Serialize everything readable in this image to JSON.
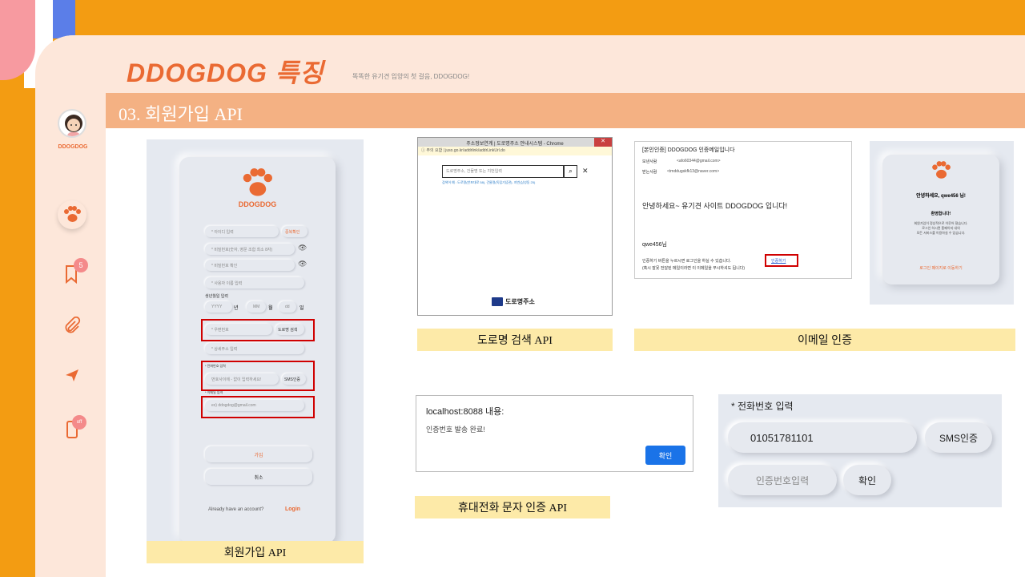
{
  "header": {
    "title": "DDOGDOG 특징",
    "subtitle": "똑똑한 유기견 입양의 첫 걸음, DDOGDOG!",
    "section": "03. 회원가입 API"
  },
  "sidebar": {
    "name": "DDOGDOG",
    "bookmark_badge": "5",
    "phone_badge": "off"
  },
  "signup": {
    "logo": "DDOGDOG",
    "id_placeholder": "* 아이디 입력",
    "id_check": "중복확인",
    "pw_placeholder": "* 비밀번호(숫자, 영문 조합 최소 8자)",
    "pw_confirm_placeholder": "* 비밀번호 확인",
    "name_placeholder": "* 사용자 이름 입력",
    "birth_label": "생년월일 입력",
    "year": "YYYY",
    "year_unit": "년",
    "month": "MM",
    "month_unit": "월",
    "day": "dd",
    "day_unit": "일",
    "zip_placeholder": "* 우편번호",
    "zip_button": "도로명 검색",
    "address_placeholder": "* 상세주소 입력",
    "phone_label": "* 전화번호 입력",
    "phone_placeholder": "번호사이에 - 없이 입력하세요!",
    "sms_button": "SMS인증",
    "email_label": "* 이메일 입력",
    "email_placeholder": "ex) ddogdog@gmail.com",
    "join_button": "가입",
    "cancel_button": "취소",
    "account_text": "Already have an account?",
    "login_link": "Login"
  },
  "road_popup": {
    "title": "주소정보연계 | 도로명주소 안내시스템 - Chrome",
    "url": "ⓘ 주의 요함 | juso.go.kr/addrlink/addrLinkUrl.do",
    "search_placeholder": "도로명주소, 건물명 또는 지번입력",
    "hint": "검색어 예 : 도로명(반포대로 58), 건물명(독립기념관), 지번(삼성동 25)",
    "brand": "도로명주소"
  },
  "email": {
    "subject": "[본인인증] DDOGDOG 인증메일입니다",
    "from_label": "보낸사람",
    "from": "<afo60344@gmail.com>",
    "to_label": "받는사람",
    "to": "<tmddugskfk13@naver.com>",
    "greeting": "안녕하세요~ 유기견 사이트 DDOGDOG 입니다!",
    "user": "qwe456님",
    "body1": "인증하기 버튼을 누르시면 로그인을 하실 수 있습니다.",
    "link": "인증하기",
    "body2": "(혹시 잘못 전달된 메일이라면 이 이메일을 무시하셔도 됩니다)"
  },
  "welcome": {
    "hello": "안녕하세요, qwe456 님!",
    "welcome": "환영합니다!",
    "msg1": "회원가입이 정상적으로 이루어 졌습니다.",
    "msg2": "로그인 하시면 홈페이지 내의",
    "msg3": "모든 서비스를 이용하실 수 있습니다.",
    "login_link": "로그인 페이지로 이동하기"
  },
  "alert": {
    "title": "localhost:8088 내용:",
    "message": "인증번호 발송 완료!",
    "ok": "확인"
  },
  "phone_zoom": {
    "label": "* 전화번호 입력",
    "number": "01051781101",
    "sms": "SMS인증",
    "code_placeholder": "인증번호입력",
    "confirm": "확인"
  },
  "captions": {
    "signup": "회원가입 API",
    "road": "도로명 검색 API",
    "email": "이메일 인증",
    "phone": "휴대전화 문자 인증 API"
  },
  "colors": {
    "accent": "#ea6a33",
    "background": "#f39c12",
    "red_box": "#d00000"
  }
}
